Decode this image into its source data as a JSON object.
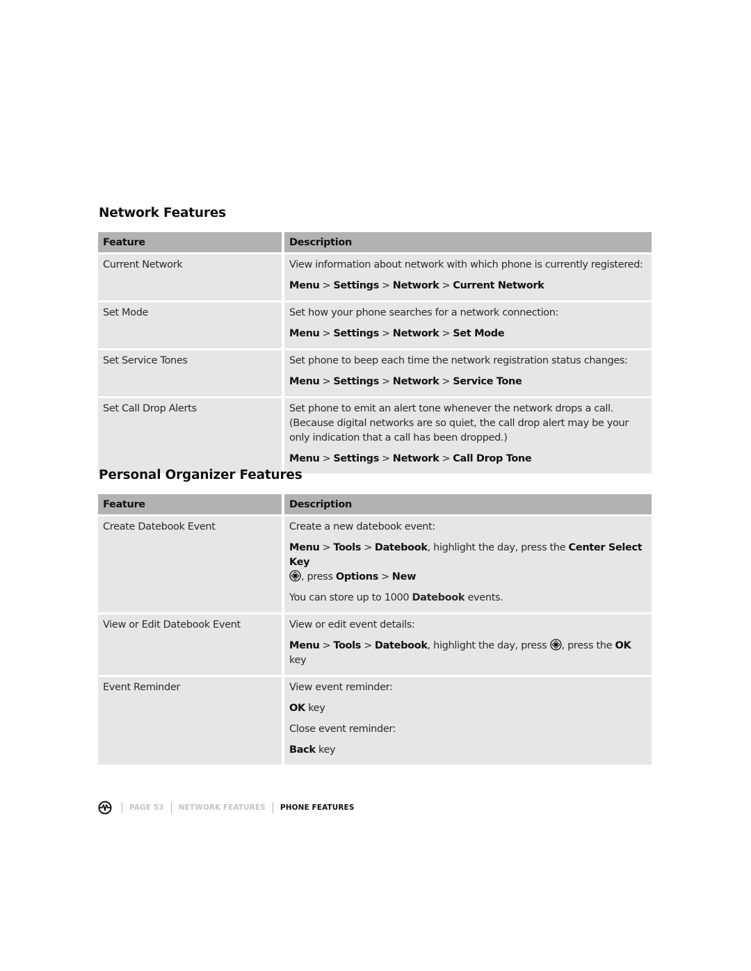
{
  "sections": {
    "network": {
      "title": "Network Features",
      "columns": [
        "Feature",
        "Description"
      ],
      "rows": [
        {
          "feature": "Current Network",
          "description": "View information about network with which phone is currently registered:",
          "path": [
            "Menu",
            "Settings",
            "Network",
            "Current Network"
          ]
        },
        {
          "feature": "Set Mode",
          "description": "Set how your phone searches for a network connection:",
          "path": [
            "Menu",
            "Settings",
            "Network",
            "Set Mode"
          ]
        },
        {
          "feature": "Set Service Tones",
          "description": "Set phone to beep each time the network registration status changes:",
          "path": [
            "Menu",
            "Settings",
            "Network",
            "Service Tone"
          ]
        },
        {
          "feature": "Set Call Drop Alerts",
          "description": "Set phone to emit an alert tone whenever the network drops a call. (Because digital networks are so quiet, the call drop alert may be your only indication that a call has been dropped.)",
          "path": [
            "Menu",
            "Settings",
            "Network",
            "Call Drop Tone"
          ]
        }
      ]
    },
    "organizer": {
      "title": "Personal Organizer Features",
      "columns": [
        "Feature",
        "Description"
      ],
      "rows": [
        {
          "feature": "Create Datebook Event",
          "description": "Create a new datebook event:",
          "path": [
            "Menu",
            "Tools",
            "Datebook"
          ],
          "path_suffix_1": ", highlight the day, press the ",
          "key_name": "Center Select Key",
          "path_suffix_2": ", press ",
          "options_path": [
            "Options",
            "New"
          ],
          "note_prefix": "You can store up to 1000 ",
          "note_bold": "Datebook",
          "note_suffix": " events."
        },
        {
          "feature": "View or Edit Datebook Event",
          "description": "View or edit event details:",
          "path": [
            "Menu",
            "Tools",
            "Datebook"
          ],
          "path_suffix_1": ", highlight the day, press ",
          "path_suffix_2": ", press the ",
          "key_bold": "OK",
          "key_suffix": " key"
        },
        {
          "feature": "Event Reminder",
          "view_label": "View event reminder:",
          "view_key_bold": "OK",
          "view_key_suffix": " key",
          "close_label": "Close event reminder:",
          "close_key_bold": "Back",
          "close_key_suffix": " key"
        }
      ]
    }
  },
  "footer": {
    "icon": "phone-brand-icon",
    "page": "PAGE 53",
    "section": "NETWORK FEATURES",
    "chapter": "PHONE FEATURES"
  },
  "separator": ">",
  "icons": {
    "center_select": "center-select-key-icon"
  }
}
